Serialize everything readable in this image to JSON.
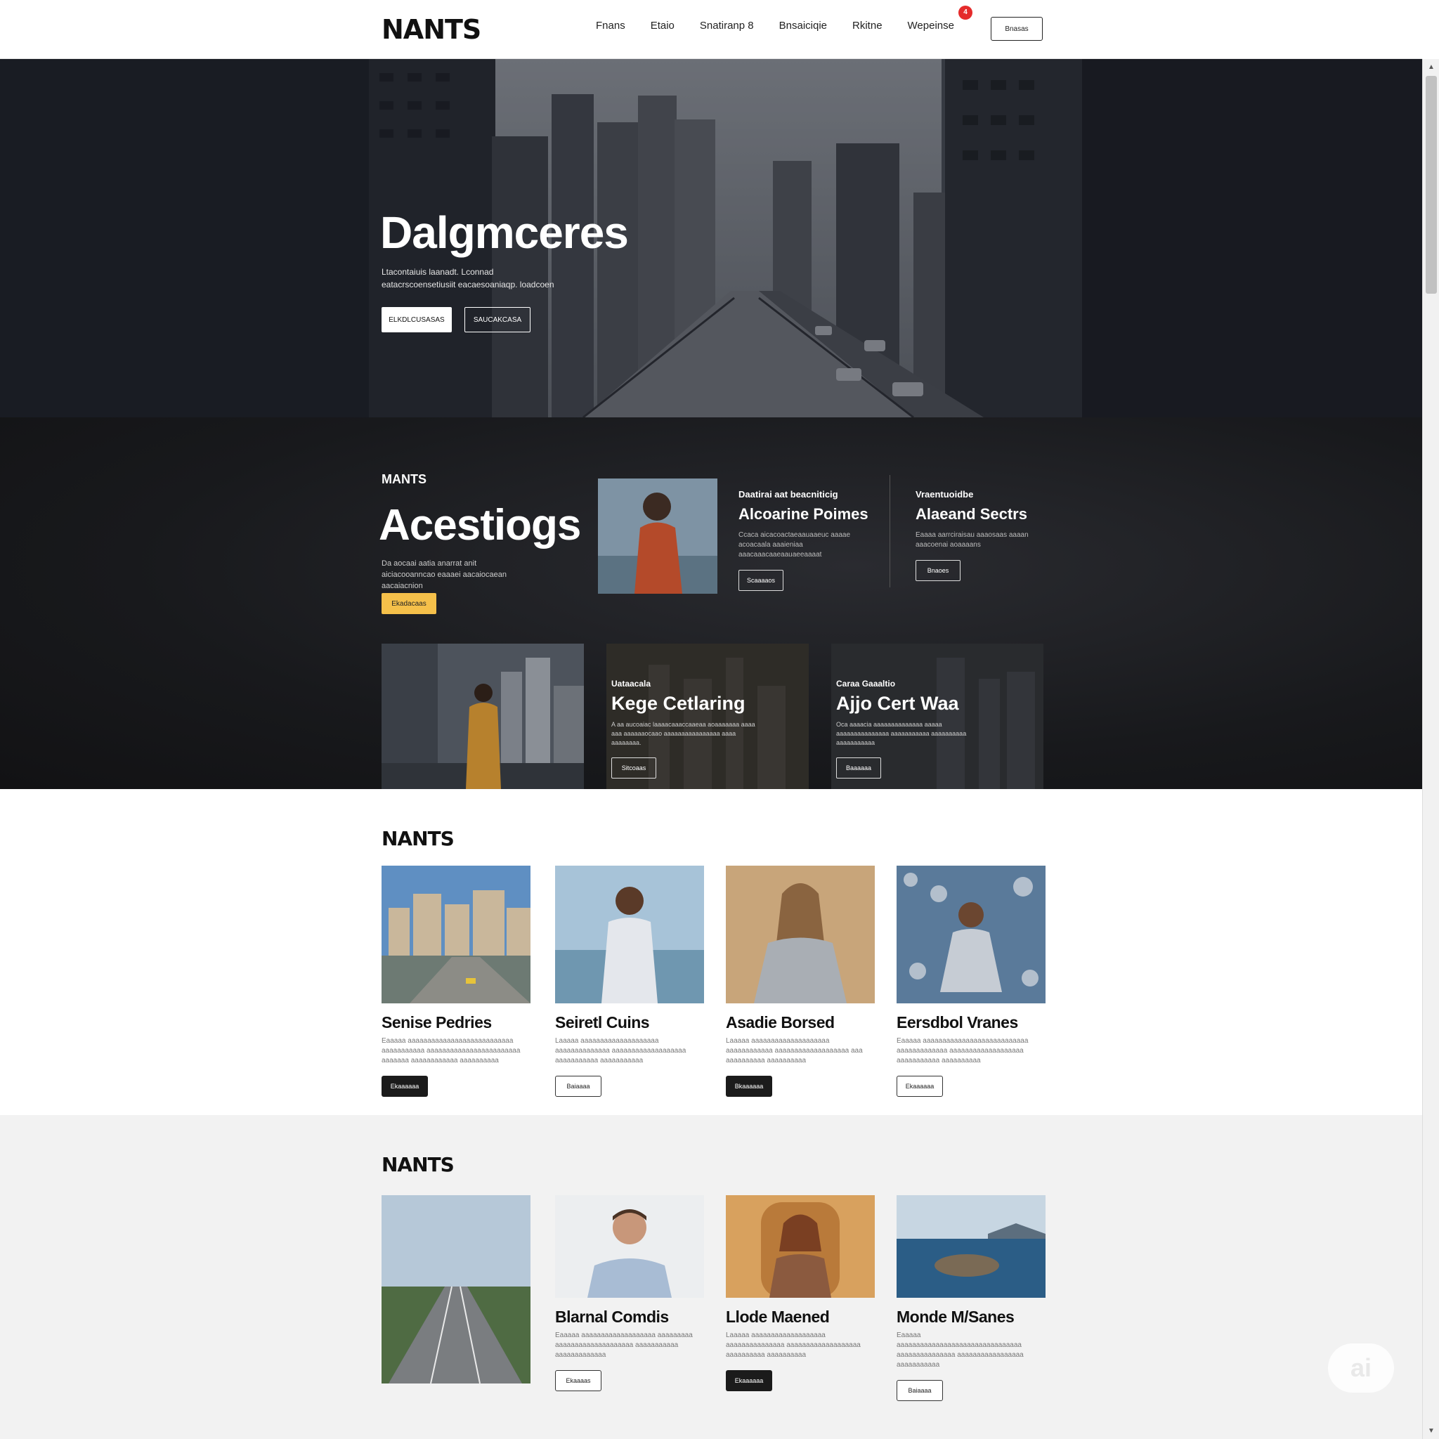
{
  "header": {
    "logo": "NANTS",
    "nav": [
      "Fnans",
      "Etaio",
      "Snatiranp 8",
      "Bnsaiciqie",
      "Rkitne",
      "Wepeinse"
    ],
    "notification_count": "4",
    "button_label": "Bnasas"
  },
  "hero": {
    "title": "Dalgmceres",
    "subtitle": "Ltacontaiuis laanadt. Lconnad eatacrscoensetiusiit eacaesoaniaqp. loadcoen",
    "primary_button": "ELKDLCUSASAS",
    "secondary_button": "SAUCAKCASA"
  },
  "featured": {
    "eyebrow": "MANTS",
    "title": "Acestiogs",
    "text": "Da aocaai aatia anarrat anit aiciacooanncao eaaaei aacaiocaean aacaiacnion",
    "button": "Ekadacaas",
    "items": [
      {
        "eyebrow": "Daatirai aat beacniticig",
        "title": "Alcoarine Poimes",
        "text": "Ccaca aicacoactaeaauaaeuc aaaae acoacaala aaaieniaa aaacaaacaaeaauaeeaaaat",
        "button": "Scaaaaos"
      },
      {
        "eyebrow": "Vraentuoidbe",
        "title": "Alaeand Sectrs",
        "text": "Eaaaa aarrciraisau aaaosaas aaaan aaacoenai aoaaaans",
        "button": "Bnaoes"
      }
    ],
    "tiles": [
      {
        "eyebrow": "Uataacala",
        "title": "Kege Cetlaring",
        "text": "A aa aucoaiac laaaacaaaccaaeaa aoaaaaaaa aaaa aaa aaaaaaocaao aaaaaaaaaaaaaaaa aaaa aaaaaaaa.",
        "button": "Sitcoaas"
      },
      {
        "eyebrow": "Caraa Gaaaltio",
        "title": "Ajjo Cert Waa",
        "text": "Oca aaaacia aaaaaaaaaaaaaa aaaaa aaaaaaaaaaaaaaa aaaaaaaaaaa aaaaaaaaaa aaaaaaaaaaa",
        "button": "Baaaaaa"
      }
    ]
  },
  "section1": {
    "title": "NANTS",
    "cards": [
      {
        "title": "Senise Pedries",
        "text": "Eaaaaa aaaaaaaaaaaaaaaaaaaaaaaaaaa aaaaaaaaaaa aaaaaaaaaaaaaaaaaaaaaaaa aaaaaaa aaaaaaaaaaaa aaaaaaaaaa",
        "button": "Ekaaaaaa"
      },
      {
        "title": "Seiretl Cuins",
        "text": "Laaaaa aaaaaaaaaaaaaaaaaaaa aaaaaaaaaaaaaa aaaaaaaaaaaaaaaaaaa aaaaaaaaaaa aaaaaaaaaaa",
        "button": "Baiaaaa"
      },
      {
        "title": "Asadie Borsed",
        "text": "Laaaaa aaaaaaaaaaaaaaaaaaaa aaaaaaaaaaaa aaaaaaaaaaaaaaaaaaa aaa aaaaaaaaaa aaaaaaaaaa",
        "button": "Bkaaaaaa"
      },
      {
        "title": "Eersdbol Vranes",
        "text": "Eaaaaa aaaaaaaaaaaaaaaaaaaaaaaaaaa aaaaaaaaaaaaa aaaaaaaaaaaaaaaaaaa aaaaaaaaaaa aaaaaaaaaa",
        "button": "Ekaaaaaa"
      }
    ]
  },
  "section2": {
    "title": "NANTS",
    "cards": [
      {
        "title": "",
        "text": "",
        "button": ""
      },
      {
        "title": "Blarnal Comdis",
        "text": "Eaaaaa aaaaaaaaaaaaaaaaaaa aaaaaaaaa aaaaaaaaaaaaaaaaaaaa aaaaaaaaaaa aaaaaaaaaaaaa",
        "button": "Ekaaaas"
      },
      {
        "title": "Llode Maened",
        "text": "Laaaaa aaaaaaaaaaaaaaaaaaa aaaaaaaaaaaaaaa aaaaaaaaaaaaaaaaaaa aaaaaaaaaa aaaaaaaaaa",
        "button": "Ekaaaaaa"
      },
      {
        "title": "Monde M/Sanes",
        "text": "Eaaaaa aaaaaaaaaaaaaaaaaaaaaaaaaaaaaaaa aaaaaaaaaaaaaaa aaaaaaaaaaaaaaaaa aaaaaaaaaaa",
        "button": "Baiaaaa"
      }
    ]
  },
  "watermark": "ai"
}
